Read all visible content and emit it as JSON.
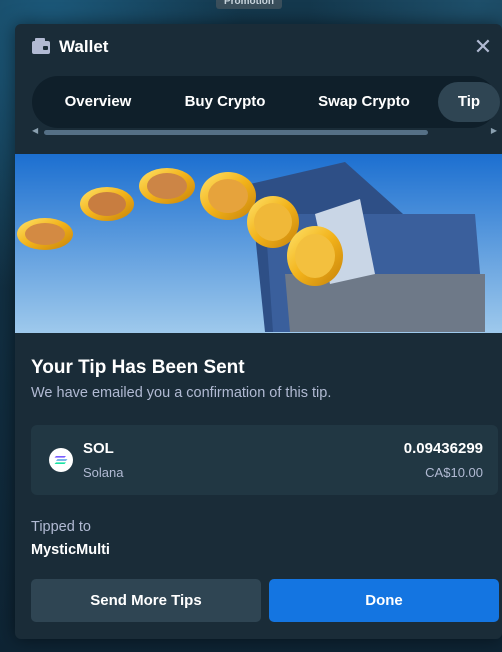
{
  "background": {
    "promo_label": "Promotion",
    "footer_text": "......"
  },
  "modal": {
    "title": "Wallet",
    "icons": {
      "wallet": "wallet-icon",
      "close": "close-icon"
    },
    "tabs": [
      {
        "label": "Overview",
        "active": false
      },
      {
        "label": "Buy Crypto",
        "active": false
      },
      {
        "label": "Swap Crypto",
        "active": false
      },
      {
        "label": "Tip",
        "active": true
      }
    ],
    "confirmation": {
      "title": "Your Tip Has Been Sent",
      "subtitle": "We have emailed you a confirmation of this tip."
    },
    "tip": {
      "currency_symbol": "SOL",
      "currency_name": "Solana",
      "amount": "0.09436299",
      "fiat_amount": "CA$10.00",
      "icon": "solana-icon"
    },
    "recipient": {
      "label": "Tipped to",
      "name": "MysticMulti"
    },
    "buttons": {
      "send_more": "Send More Tips",
      "done": "Done"
    }
  },
  "colors": {
    "modal_bg": "#1a2c38",
    "card_bg": "#213743",
    "primary": "#1475e1",
    "secondary": "#2f4553",
    "muted_text": "#b1bad3"
  }
}
